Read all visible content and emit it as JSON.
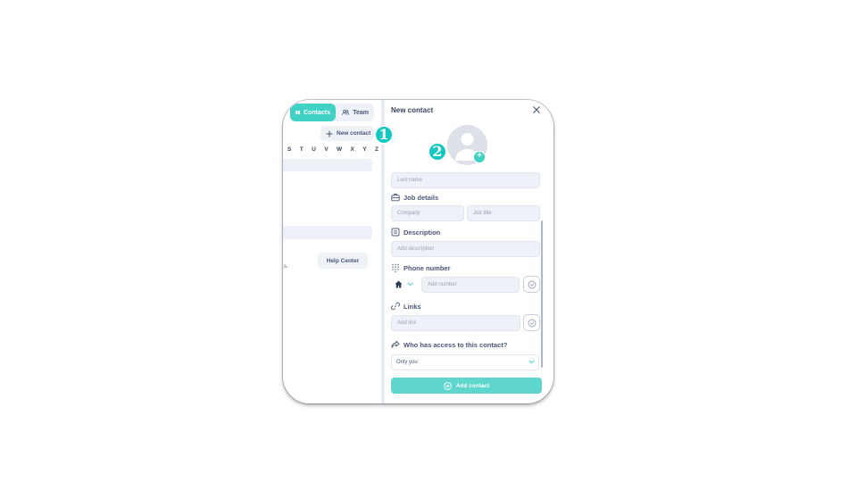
{
  "sidebar": {
    "tabs": [
      {
        "label": "Contacts",
        "active": true,
        "icon": "address-book-icon"
      },
      {
        "label": "Team",
        "active": false,
        "icon": "people-icon"
      }
    ],
    "new_contact_label": "New contact",
    "alphabet": [
      "S",
      "T",
      "U",
      "V",
      "W",
      "X",
      "Y",
      "Z"
    ],
    "help_label": "Help Center",
    "fragment_text": "s."
  },
  "form": {
    "title": "New contact",
    "last_name_placeholder": "Last name",
    "job_details": {
      "label": "Job details",
      "company_placeholder": "Company",
      "job_title_placeholder": "Job title"
    },
    "description": {
      "label": "Description",
      "placeholder": "Add description"
    },
    "phone": {
      "label": "Phone number",
      "placeholder": "Add number",
      "type_icon": "home-icon"
    },
    "links": {
      "label": "Links",
      "placeholder": "Add link"
    },
    "access": {
      "label": "Who has access to this contact?",
      "value": "Only you"
    },
    "submit_label": "Add contact"
  },
  "annotations": {
    "step1": "1",
    "step2": "2"
  },
  "colors": {
    "accent": "#41d1c5",
    "badge": "#12c8c1",
    "text": "#4a5677"
  }
}
